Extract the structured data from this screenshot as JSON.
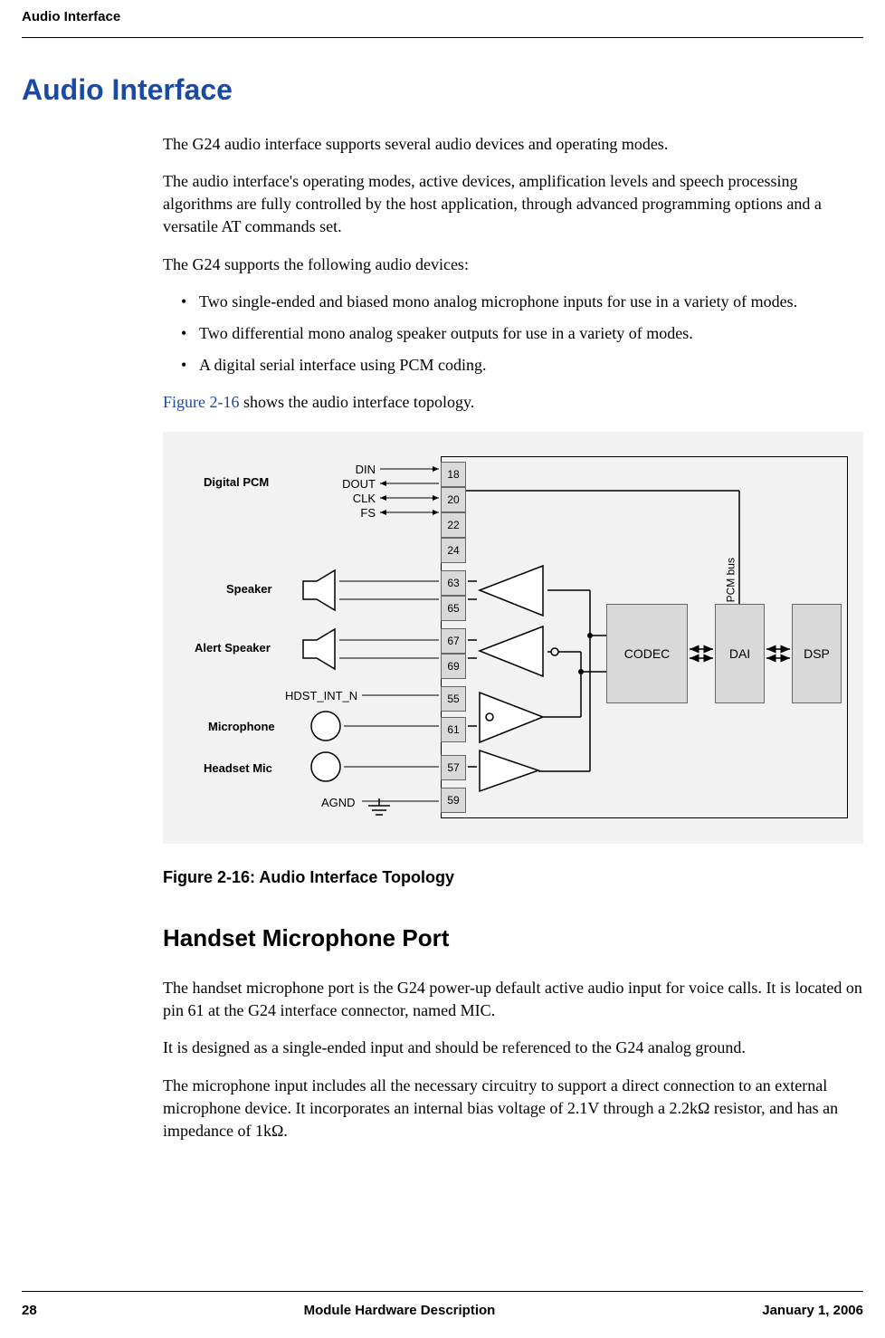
{
  "header": {
    "running_head": "Audio Interface"
  },
  "section": {
    "title": "Audio Interface",
    "para1": "The G24 audio interface supports several audio devices and operating modes.",
    "para2": "The audio interface's operating modes, active devices, amplification levels and speech processing algorithms are fully controlled by the host application, through advanced programming options and a versatile AT commands set.",
    "para3": "The G24 supports the following audio devices:",
    "bullets": [
      "Two single-ended and biased mono analog microphone inputs for use in a variety of modes.",
      "Two differential mono analog speaker outputs for use in a variety of modes.",
      "A digital serial interface using PCM coding."
    ],
    "para4_prefix": "",
    "figure_ref": "Figure 2-16",
    "para4_suffix": " shows the audio interface topology.",
    "figure_caption": "Figure 2-16: Audio Interface Topology"
  },
  "diagram": {
    "labels": {
      "digital_pcm": "Digital PCM",
      "din": "DIN",
      "dout": "DOUT",
      "clk": "CLK",
      "fs": "FS",
      "speaker": "Speaker",
      "alert_speaker": "Alert Speaker",
      "hdst_int_n": "HDST_INT_N",
      "microphone": "Microphone",
      "headset_mic": "Headset Mic",
      "agnd": "AGND",
      "codec": "CODEC",
      "dai": "DAI",
      "dsp": "DSP",
      "pcm_bus": "PCM bus"
    },
    "pins": [
      "18",
      "20",
      "22",
      "24",
      "63",
      "65",
      "67",
      "69",
      "55",
      "61",
      "57",
      "59"
    ]
  },
  "subsection": {
    "title": "Handset Microphone Port",
    "para1": "The handset microphone port is the G24 power-up default active audio input for voice calls. It is located on pin 61 at the G24 interface connector, named MIC.",
    "para2": "It is designed as a single-ended input and should be referenced to the G24 analog ground.",
    "para3": "The microphone input includes all the necessary circuitry to support a direct connection to an external microphone device. It incorporates an internal bias voltage of 2.1V through a 2.2kΩ resistor, and has an impedance of 1kΩ."
  },
  "footer": {
    "page": "28",
    "center": "Module Hardware Description",
    "date": "January 1, 2006"
  }
}
